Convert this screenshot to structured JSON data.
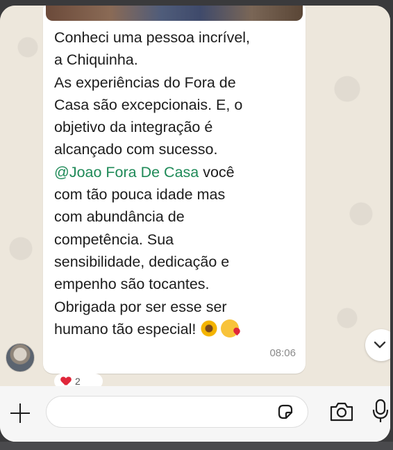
{
  "message": {
    "lines_before_mention": "Conheci uma pessoa incrível,\na Chiquinha.\nAs experiências do Fora de\nCasa são excepcionais. E, o\nobjetivo da integração é\nalcançado com sucesso.\n",
    "mention": "@Joao Fora De Casa",
    "lines_after_mention": " você\ncom tão pouca idade mas\ncom abundância de\ncompetência. Sua\nsensibilidade, dedicação e\nempenho são tocantes.\nObrigada por ser esse ser\nhumano tão especial!",
    "emojis": [
      "sunflower-icon",
      "face-blowing-kiss-icon"
    ],
    "time": "08:06",
    "reaction_count": "2"
  },
  "composer": {
    "placeholder": ""
  },
  "colors": {
    "mention": "#1f8a58",
    "bubble": "#ffffff",
    "wallpaper": "#ede7dc"
  }
}
